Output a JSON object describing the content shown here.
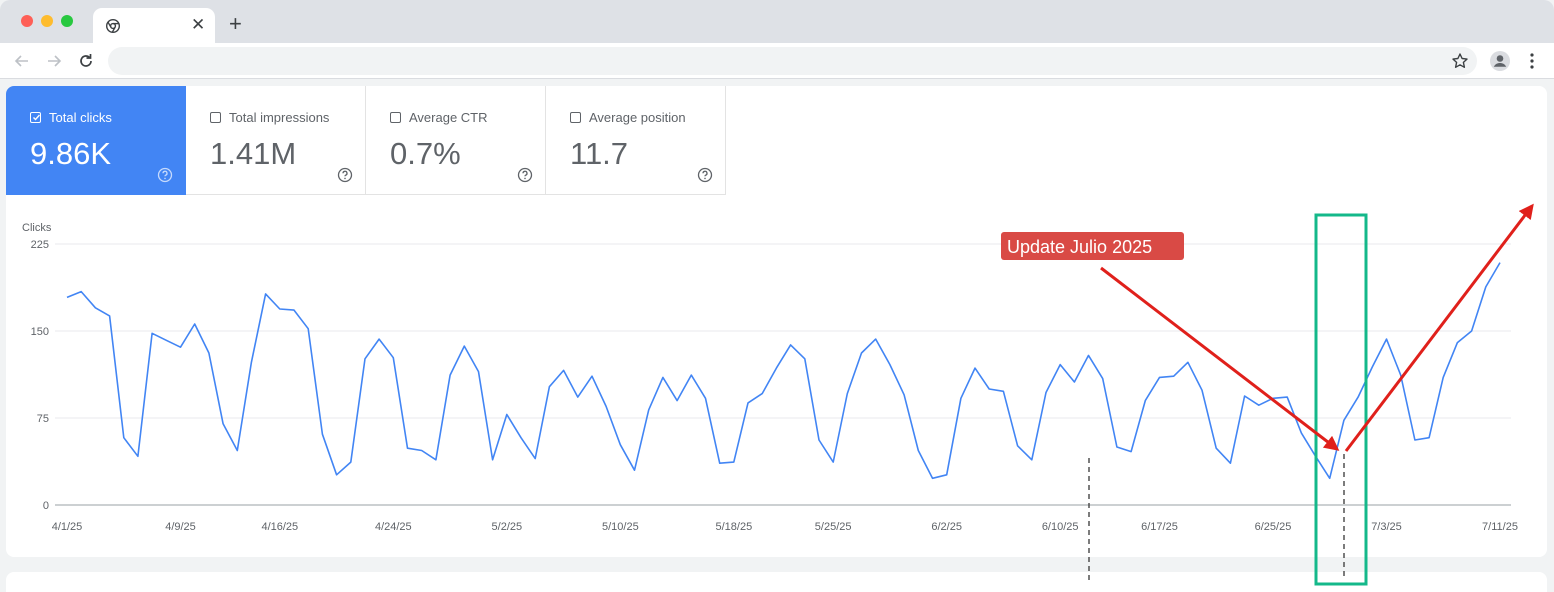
{
  "browser": {
    "tab_close": "✕",
    "new_tab": "+",
    "icons": {
      "favicon": "chrome-icon",
      "back": "arrow-back-icon",
      "forward": "arrow-forward-icon",
      "reload": "reload-icon",
      "bookmark": "star-icon",
      "profile": "profile-icon",
      "menu": "more-vert-icon"
    }
  },
  "metrics": [
    {
      "label": "Total clicks",
      "value": "9.86K",
      "checked": true
    },
    {
      "label": "Total impressions",
      "value": "1.41M",
      "checked": false
    },
    {
      "label": "Average CTR",
      "value": "0.7%",
      "checked": false
    },
    {
      "label": "Average position",
      "value": "11.7",
      "checked": false
    }
  ],
  "colors": {
    "accent": "#4285f4",
    "annotation_red": "#e0201b",
    "highlight_green": "#14b88a",
    "label_bg": "#d94a45"
  },
  "chart_data": {
    "type": "line",
    "ylabel": "Clicks",
    "ylim": [
      0,
      225
    ],
    "yticks": [
      0,
      75,
      150,
      225
    ],
    "xlim": [
      "2025-04-01",
      "2025-07-11"
    ],
    "x_tick_labels": [
      "4/1/25",
      "4/9/25",
      "4/16/25",
      "4/24/25",
      "5/2/25",
      "5/10/25",
      "5/18/25",
      "5/25/25",
      "6/2/25",
      "6/10/25",
      "6/17/25",
      "6/25/25",
      "7/3/25",
      "7/11/25"
    ],
    "x_tick_dates": [
      "2025-04-01",
      "2025-04-09",
      "2025-04-16",
      "2025-04-24",
      "2025-05-02",
      "2025-05-10",
      "2025-05-18",
      "2025-05-25",
      "2025-06-02",
      "2025-06-10",
      "2025-06-17",
      "2025-06-25",
      "2025-07-03",
      "2025-07-11"
    ],
    "grid": true,
    "series": [
      {
        "color": "#4285f4",
        "start_date": "2025-04-01",
        "values": [
          179,
          184,
          170,
          163,
          58,
          42,
          148,
          142,
          136,
          156,
          131,
          70,
          47,
          123,
          182,
          169,
          168,
          152,
          61,
          26,
          37,
          126,
          143,
          127,
          49,
          47,
          39,
          112,
          137,
          115,
          39,
          78,
          58,
          40,
          102,
          116,
          93,
          111,
          85,
          52,
          30,
          82,
          110,
          90,
          112,
          92,
          36,
          37,
          88,
          96,
          118,
          138,
          126,
          56,
          37,
          96,
          131,
          143,
          121,
          95,
          47,
          23,
          26,
          92,
          118,
          100,
          98,
          51,
          39,
          97,
          121,
          106,
          129,
          109,
          50,
          46,
          90,
          110,
          111,
          123,
          99,
          49,
          36,
          94,
          86,
          92,
          93,
          62,
          42,
          23,
          73,
          93,
          119,
          143,
          112,
          56,
          58,
          110,
          140,
          150,
          188,
          209
        ]
      }
    ],
    "annotations": [
      {
        "type": "label",
        "text": "Update Julio 2025"
      }
    ]
  }
}
